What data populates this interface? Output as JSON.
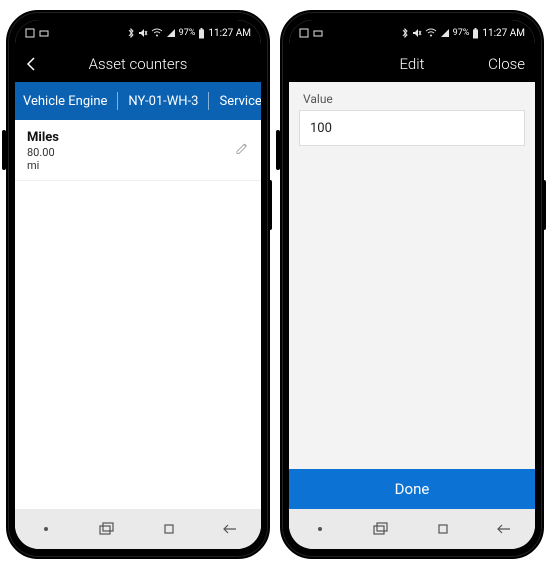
{
  "status_bar": {
    "battery_text": "97%",
    "time": "11:27 AM"
  },
  "screen_list": {
    "title": "Asset counters",
    "breadcrumb": {
      "asset_type": "Vehicle Engine",
      "asset_id": "NY-01-WH-3",
      "tail": "Service"
    },
    "counter": {
      "name": "Miles",
      "value": "80.00",
      "unit": "mi"
    }
  },
  "screen_edit": {
    "title": "Edit",
    "close_label": "Close",
    "field_label": "Value",
    "field_value": "100",
    "done_label": "Done"
  }
}
